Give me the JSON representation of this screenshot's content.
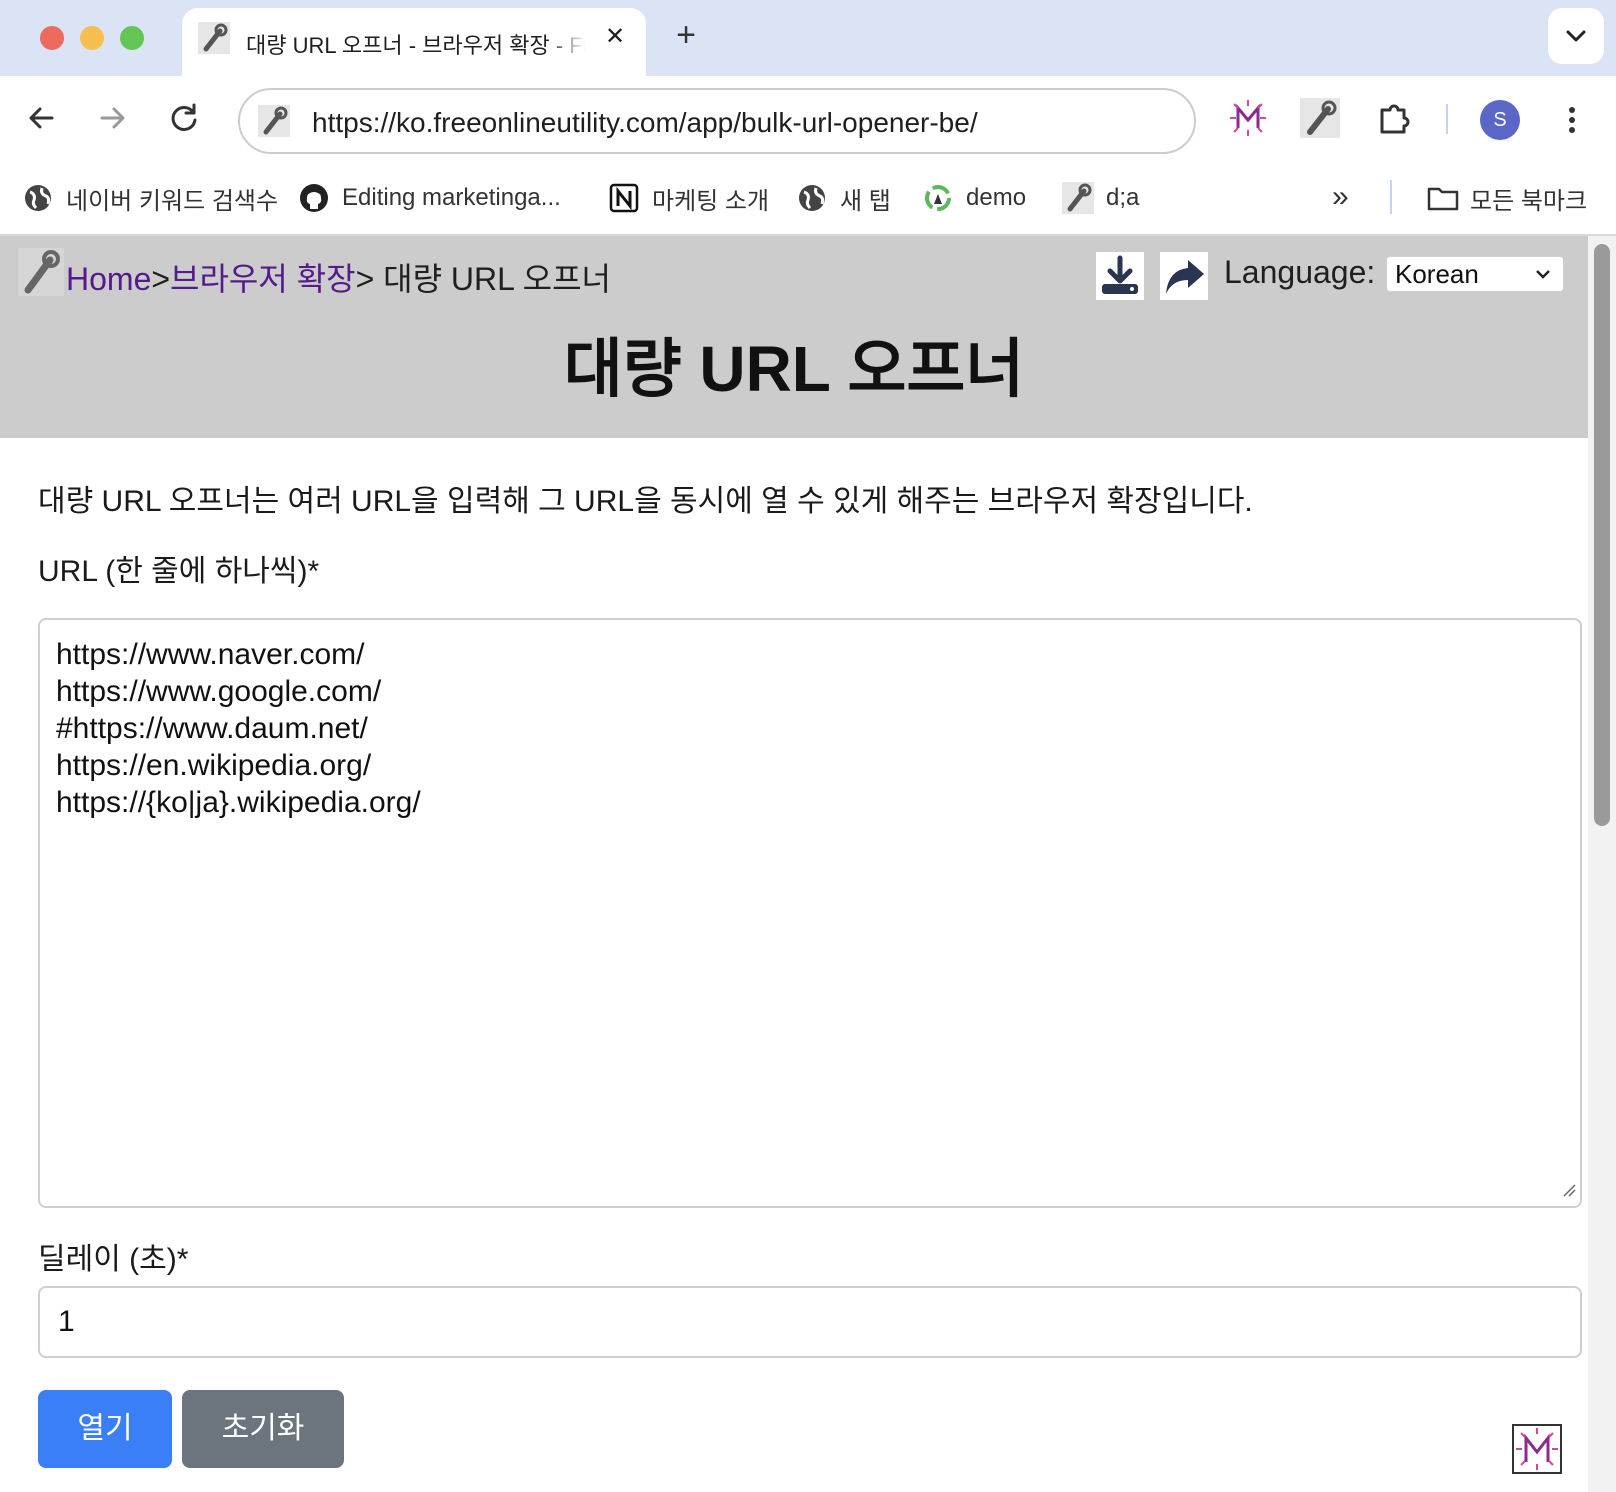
{
  "browser": {
    "tab": {
      "title": "대량 URL 오프너 - 브라우저 확장 - FreeOnlineUtility"
    },
    "address_bar": {
      "url": "https://ko.freeonlineutility.com/app/bulk-url-opener-be/"
    },
    "profile_initial": "S",
    "bookmarks": [
      {
        "label": "네이버 키워드 검색수",
        "icon": "globe-icon"
      },
      {
        "label": "Editing marketinga...",
        "icon": "github-icon"
      },
      {
        "label": "마케팅 소개",
        "icon": "notion-icon"
      },
      {
        "label": "새 탭",
        "icon": "globe-icon"
      },
      {
        "label": "demo",
        "icon": "recycle-icon"
      },
      {
        "label": "d;a",
        "icon": "wrench-icon"
      }
    ],
    "all_bookmarks_label": "모든 북마크"
  },
  "header": {
    "breadcrumb": {
      "home": "Home",
      "separator1": ">",
      "category": "브라우저 확장",
      "current": "> 대량 URL 오프너"
    },
    "language_label": "Language:",
    "language_selected": "Korean",
    "title": "대량 URL 오프너"
  },
  "main": {
    "intro": "대량 URL 오프너는 여러 URL을 입력해 그 URL을 동시에 열 수 있게 해주는 브라우저 확장입니다.",
    "url_label": "URL (한 줄에 하나씩)*",
    "urls": [
      "https://www.naver.com/",
      "https://www.google.com/",
      "#https://www.daum.net/",
      "https://en.wikipedia.org/",
      "https://{ko|ja}.wikipedia.org/"
    ],
    "delay_label": "딜레이 (초)*",
    "delay_value": "1",
    "open_button": "열기",
    "reset_button": "초기화"
  },
  "colors": {
    "header_bg": "#cccccc",
    "link": "#551a8b",
    "primary_button": "#3b7ff6",
    "secondary_button": "#6c757d"
  }
}
